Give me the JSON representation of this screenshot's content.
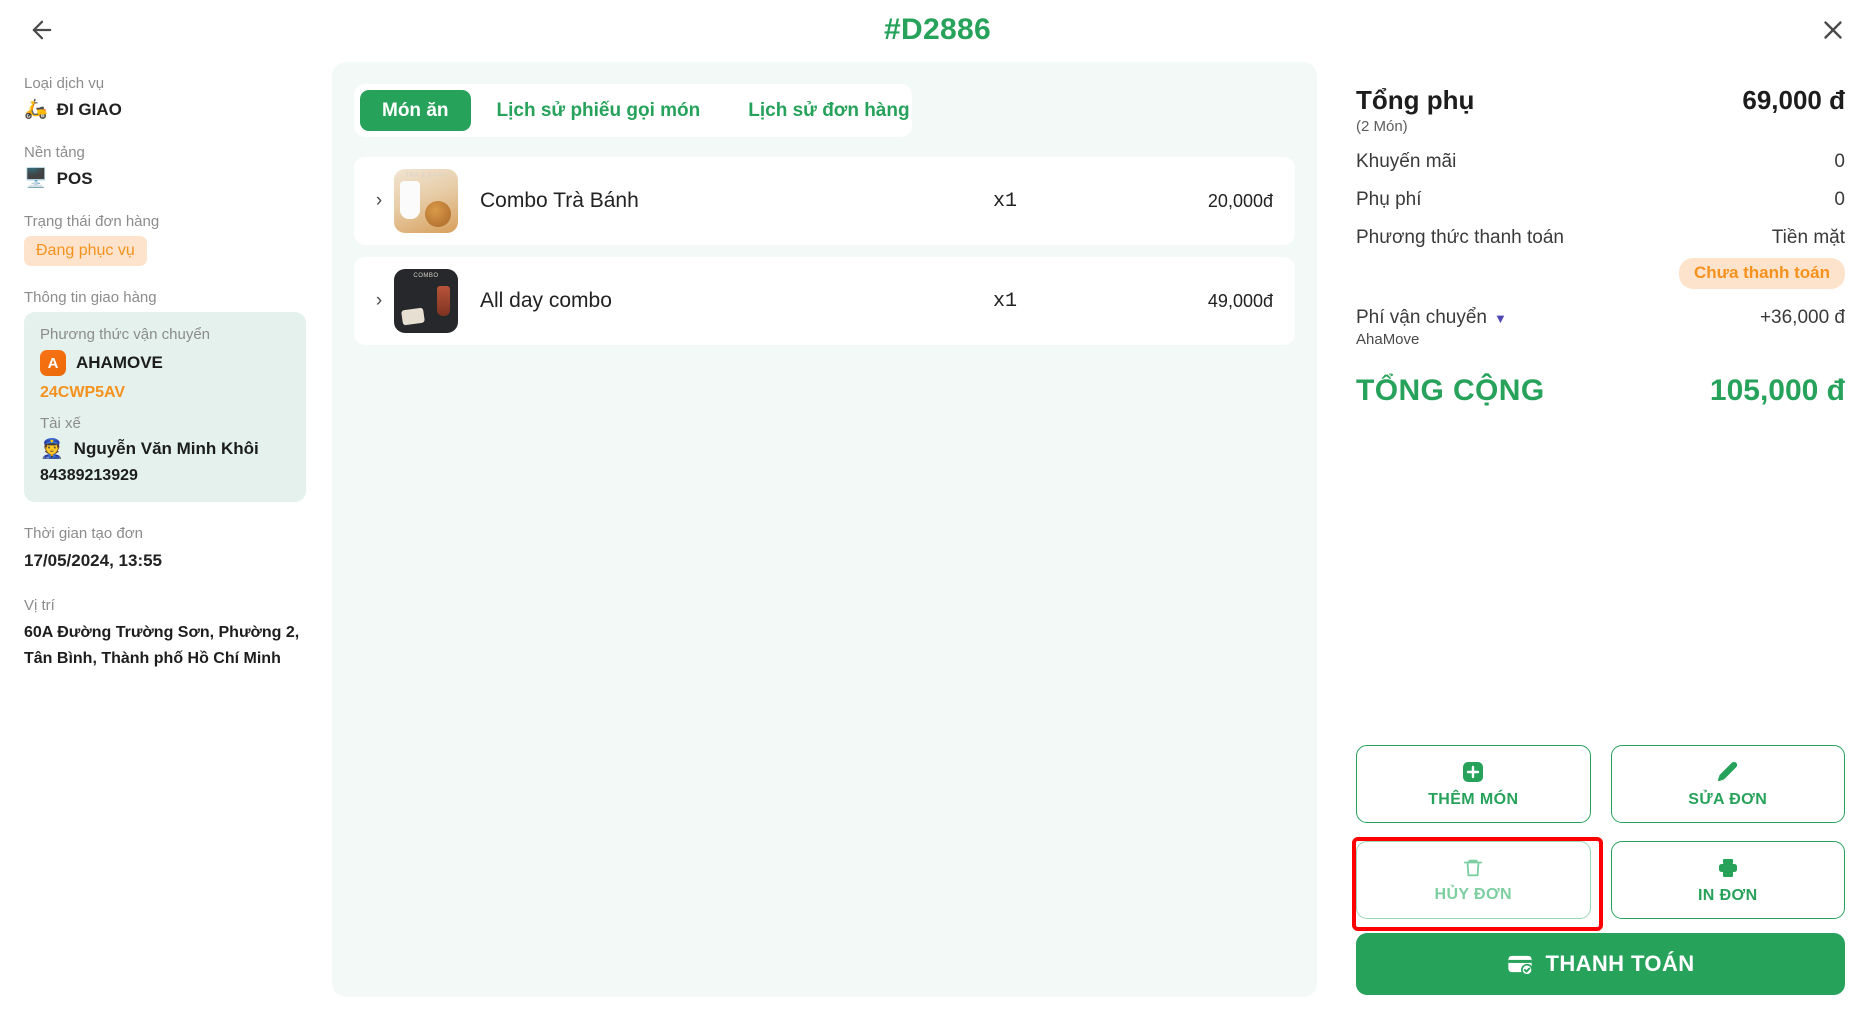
{
  "header": {
    "order_code": "#D2886",
    "back_icon": "arrow-left-icon",
    "close_icon": "close-icon",
    "accent_color": "#27a25b"
  },
  "sidebar": {
    "service_type": {
      "label": "Loại dịch vụ",
      "value": "ĐI GIAO",
      "icon": "delivery-scooter-icon"
    },
    "platform": {
      "label": "Nền tảng",
      "value": "POS",
      "icon": "pos-terminal-icon"
    },
    "order_status": {
      "label": "Trạng thái đơn hàng",
      "badge": "Đang phục vụ",
      "badge_color": "#f5921e",
      "badge_bg": "#fde3cc"
    },
    "delivery_info": {
      "label": "Thông tin giao hàng",
      "shipping_method_label": "Phương thức vận chuyển",
      "provider": "AHAMOVE",
      "provider_icon": "ahamove-logo-icon",
      "tracking_code": "24CWP5AV",
      "driver_label": "Tài xế",
      "driver_name": "Nguyễn Văn Minh Khôi",
      "driver_icon": "driver-avatar-icon",
      "driver_phone": "84389213929"
    },
    "created_time": {
      "label": "Thời gian tạo đơn",
      "value": "17/05/2024, 13:55"
    },
    "location": {
      "label": "Vị trí",
      "value": "60A Đường Trường Sơn, Phường 2, Tân Bình, Thành phố Hồ Chí Minh"
    }
  },
  "main": {
    "tabs": [
      {
        "label": "Món ăn",
        "active": true
      },
      {
        "label": "Lịch sử phiếu gọi món",
        "active": false
      },
      {
        "label": "Lịch sử đơn hàng",
        "active": false
      }
    ],
    "items": [
      {
        "name": "Combo Trà Bánh",
        "qty": "x1",
        "price": "20,000đ",
        "expand_icon": "chevron-right-icon",
        "thumb": "combo-tra-banh-thumb"
      },
      {
        "name": "All day combo",
        "qty": "x1",
        "price": "49,000đ",
        "expand_icon": "chevron-right-icon",
        "thumb": "all-day-combo-thumb"
      }
    ]
  },
  "summary": {
    "subtotal_label": "Tổng phụ",
    "subtotal_value": "69,000 đ",
    "item_count": "(2 Món)",
    "discount_label": "Khuyến mãi",
    "discount_value": "0",
    "surcharge_label": "Phụ phí",
    "surcharge_value": "0",
    "payment_method_label": "Phương thức thanh toán",
    "payment_method_value": "Tiền mặt",
    "payment_status_badge": "Chưa thanh toán",
    "shipping_label": "Phí vận chuyển",
    "shipping_provider": "AhaMove",
    "shipping_value": "+36,000 đ",
    "shipping_caret_icon": "caret-down-icon",
    "total_label": "TỔNG CỘNG",
    "total_value": "105,000 đ"
  },
  "actions": {
    "add_item": {
      "label": "THÊM MÓN",
      "icon": "plus-square-icon"
    },
    "edit_order": {
      "label": "SỬA ĐƠN",
      "icon": "pencil-icon"
    },
    "cancel_order": {
      "label": "HỦY ĐƠN",
      "icon": "trash-icon",
      "highlighted": true,
      "highlight_color": "#ff0000"
    },
    "print_order": {
      "label": "IN ĐƠN",
      "icon": "printer-icon"
    },
    "pay": {
      "label": "THANH TOÁN",
      "icon": "card-check-icon"
    }
  }
}
